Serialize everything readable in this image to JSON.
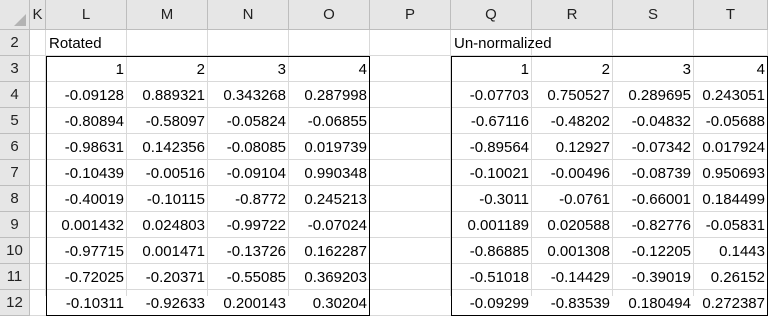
{
  "columns": [
    "K",
    "L",
    "M",
    "N",
    "O",
    "P",
    "Q",
    "R",
    "S",
    "T"
  ],
  "rows": [
    "2",
    "3",
    "4",
    "5",
    "6",
    "7",
    "8",
    "9",
    "10",
    "11",
    "12"
  ],
  "left_block": {
    "title": "Rotated",
    "headers": [
      "1",
      "2",
      "3",
      "4"
    ],
    "values": [
      [
        "-0.09128",
        "0.889321",
        "0.343268",
        "0.287998"
      ],
      [
        "-0.80894",
        "-0.58097",
        "-0.05824",
        "-0.06855"
      ],
      [
        "-0.98631",
        "0.142356",
        "-0.08085",
        "0.019739"
      ],
      [
        "-0.10439",
        "-0.00516",
        "-0.09104",
        "0.990348"
      ],
      [
        "-0.40019",
        "-0.10115",
        "-0.8772",
        "0.245213"
      ],
      [
        "0.001432",
        "0.024803",
        "-0.99722",
        "-0.07024"
      ],
      [
        "-0.97715",
        "0.001471",
        "-0.13726",
        "0.162287"
      ],
      [
        "-0.72025",
        "-0.20371",
        "-0.55085",
        "0.369203"
      ],
      [
        "-0.10311",
        "-0.92633",
        "0.200143",
        "0.30204"
      ]
    ]
  },
  "right_block": {
    "title": "Un-normalized",
    "headers": [
      "1",
      "2",
      "3",
      "4"
    ],
    "values": [
      [
        "-0.07703",
        "0.750527",
        "0.289695",
        "0.243051"
      ],
      [
        "-0.67116",
        "-0.48202",
        "-0.04832",
        "-0.05688"
      ],
      [
        "-0.89564",
        "0.12927",
        "-0.07342",
        "0.017924"
      ],
      [
        "-0.10021",
        "-0.00496",
        "-0.08739",
        "0.950693"
      ],
      [
        "-0.3011",
        "-0.0761",
        "-0.66001",
        "0.184499"
      ],
      [
        "0.001189",
        "0.020588",
        "-0.82776",
        "-0.05831"
      ],
      [
        "-0.86885",
        "0.001308",
        "-0.12205",
        "0.1443"
      ],
      [
        "-0.51018",
        "-0.14429",
        "-0.39019",
        "0.26152"
      ],
      [
        "-0.09299",
        "-0.83539",
        "0.180494",
        "0.272387"
      ]
    ]
  }
}
